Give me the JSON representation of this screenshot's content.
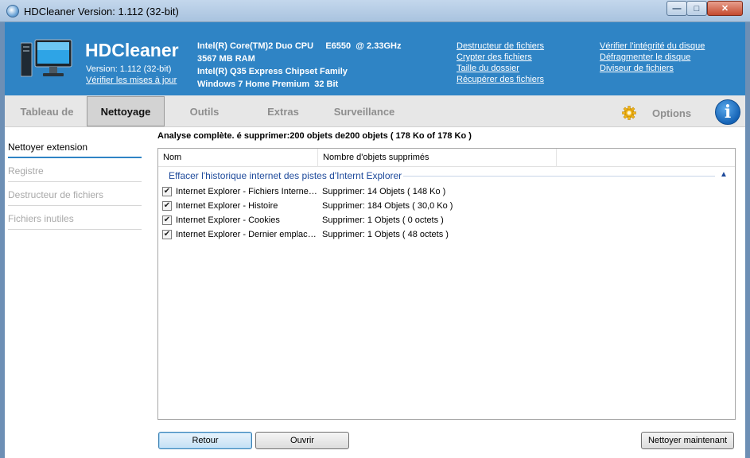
{
  "window": {
    "title": "HDCleaner Version: 1.112 (32-bit)",
    "min": "—",
    "max": "□",
    "close": "✕"
  },
  "header": {
    "brand": "HDCleaner",
    "version": "Version: 1.112 (32-bit)",
    "update_link": "Vérifier les mises à jour",
    "sysinfo": [
      "Intel(R) Core(TM)2 Duo CPU     E6550  @ 2.33GHz",
      "3567 MB RAM",
      "Intel(R) Q35 Express Chipset Family",
      "Windows 7 Home Premium  32 Bit"
    ],
    "links_col1": [
      "Destructeur de fichiers",
      "Crypter des fichiers",
      "Taille du dossier",
      "Récupérer des fichiers"
    ],
    "links_col2": [
      "Vérifier l'intégrité du disque",
      "Défragmenter le disque",
      "Diviseur de fichiers"
    ]
  },
  "tabs": [
    "Tableau de",
    "Nettoyage",
    "Outils",
    "Extras",
    "Surveillance"
  ],
  "options_label": "Options",
  "info_glyph": "i",
  "sidebar": [
    "Nettoyer extension",
    "Registre",
    "Destructeur de fichiers",
    "Fichiers inutiles"
  ],
  "summary": "Analyse complète. é supprimer:200 objets de200 objets ( 178 Ko of 178 Ko )",
  "listview": {
    "col_name": "Nom",
    "col_count": "Nombre d'objets supprimés",
    "group": "Effacer l'historique internet des pistes d'Internt Explorer",
    "group_chevron": "▲",
    "check": "✔",
    "rows": [
      {
        "name": "Internet Explorer - Fichiers Internet temporaires",
        "count": "Supprimer: 14 Objets ( 148 Ko )"
      },
      {
        "name": "Internet Explorer - Histoire",
        "count": "Supprimer: 184 Objets ( 30,0 Ko )"
      },
      {
        "name": "Internet Explorer - Cookies",
        "count": "Supprimer: 1 Objets ( 0 octets )"
      },
      {
        "name": "Internet Explorer - Dernier emplacement de téléchargement",
        "count": "Supprimer: 1 Objets ( 48 octets )"
      }
    ]
  },
  "buttons": {
    "back": "Retour",
    "open": "Ouvrir",
    "clean_now": "Nettoyer maintenant"
  }
}
